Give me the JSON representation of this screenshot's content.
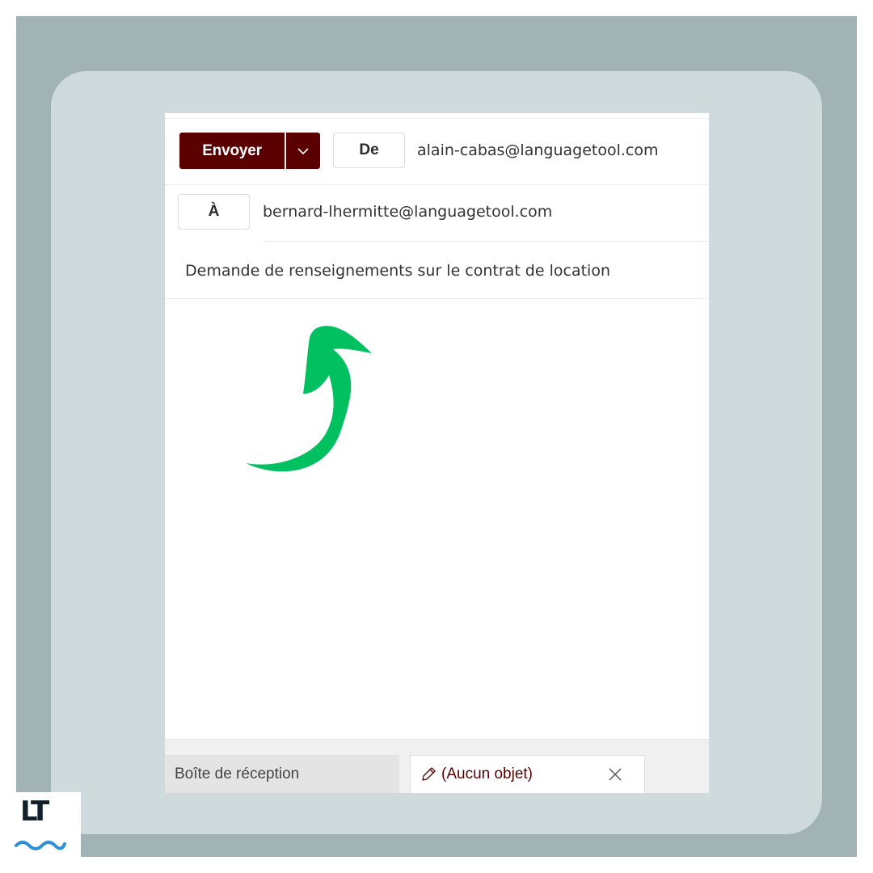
{
  "compose": {
    "send_label": "Envoyer",
    "from_label": "De",
    "from_address": "alain-cabas@languagetool.com",
    "to_label": "À",
    "to_address": "bernard-lhermitte@languagetool.com",
    "subject": "Demande de renseignements sur le contrat de location"
  },
  "tabs": {
    "inbox_label": "Boîte de réception",
    "draft_label": "(Aucun objet)"
  },
  "brand": {
    "logo_text": "LT",
    "accent": "#5b0000",
    "arrow_color": "#00c060",
    "wave_color": "#2d8fd5"
  },
  "icons": [
    "chevron-down-icon",
    "pencil-icon",
    "close-icon",
    "arrow-icon"
  ]
}
